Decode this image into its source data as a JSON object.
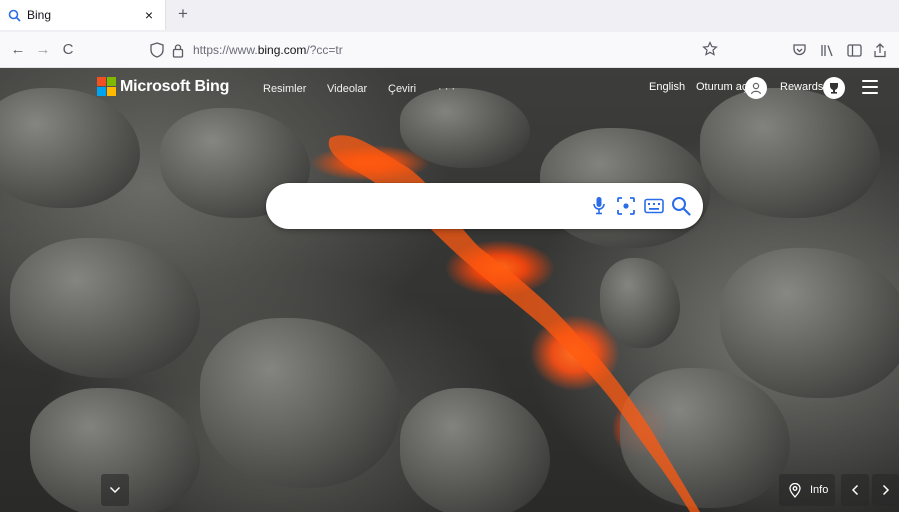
{
  "browser": {
    "tab": {
      "title": "Bing",
      "icon": "search-icon",
      "close": "×"
    },
    "new_tab": "+",
    "nav": {
      "back": "←",
      "forward": "→",
      "reload": "C"
    },
    "url": {
      "prefix": "https://www.",
      "domain": "bing.com",
      "path": "/?cc=tr"
    },
    "toolbar_icons": [
      "pocket-icon",
      "library-icon",
      "sidebar-icon",
      "share-icon"
    ]
  },
  "bing": {
    "logo_text": "Microsoft Bing",
    "nav_items": [
      "Resimler",
      "Videolar",
      "Çeviri",
      "· · ·"
    ],
    "language": "English",
    "sign_in": "Oturum aç",
    "rewards": "Rewards",
    "search": {
      "value": "",
      "placeholder": ""
    },
    "info_label": "Info",
    "colors": {
      "accent": "#2b6de8",
      "lava": "#ff5a10"
    }
  }
}
